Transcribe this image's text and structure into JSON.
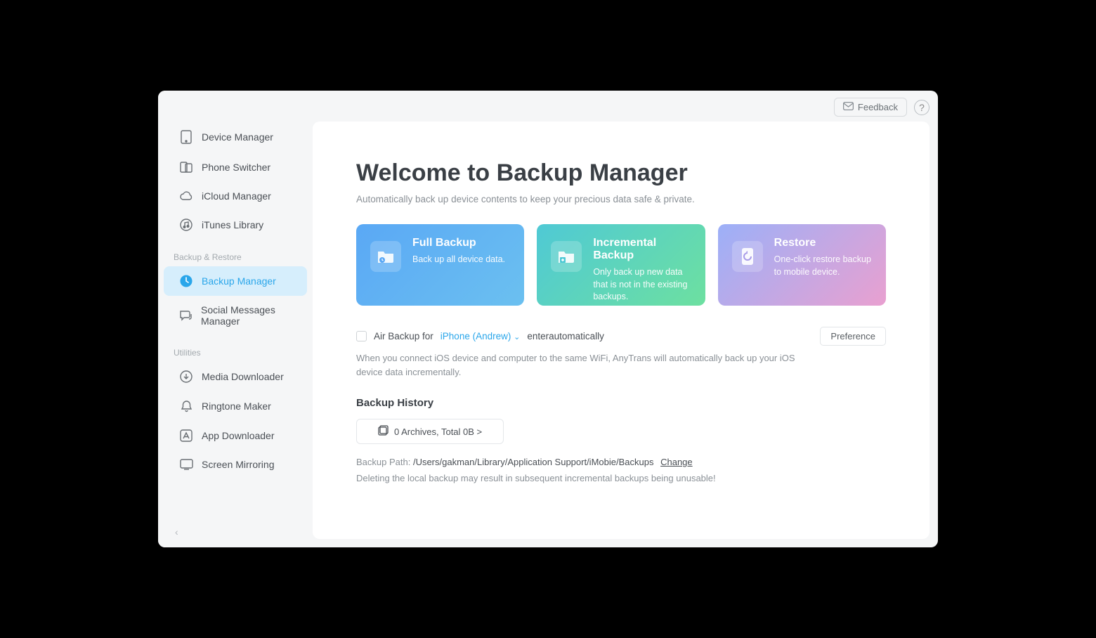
{
  "header": {
    "feedback_label": "Feedback",
    "help_label": "?"
  },
  "sidebar": {
    "items_top": [
      {
        "label": "Device Manager"
      },
      {
        "label": "Phone Switcher"
      },
      {
        "label": "iCloud Manager"
      },
      {
        "label": "iTunes Library"
      }
    ],
    "section_backup": "Backup & Restore",
    "items_backup": [
      {
        "label": "Backup Manager",
        "active": true
      },
      {
        "label": "Social Messages Manager"
      }
    ],
    "section_util": "Utilities",
    "items_util": [
      {
        "label": "Media Downloader"
      },
      {
        "label": "Ringtone Maker"
      },
      {
        "label": "App Downloader"
      },
      {
        "label": "Screen Mirroring"
      }
    ]
  },
  "main": {
    "title": "Welcome to Backup Manager",
    "subtitle": "Automatically back up device contents to keep your precious data safe & private.",
    "cards": {
      "full": {
        "title": "Full Backup",
        "desc": "Back up all device data."
      },
      "inc": {
        "title": "Incremental Backup",
        "desc": "Only back up new data that is not in the existing backups."
      },
      "rest": {
        "title": "Restore",
        "desc": "One-click restore backup to mobile device."
      }
    },
    "air": {
      "prefix": "Air Backup for",
      "device": "iPhone (Andrew)",
      "suffix": "enterautomatically",
      "desc": "When you connect iOS device and computer to the same WiFi, AnyTrans will automatically back up your iOS device data incrementally.",
      "preference_label": "Preference"
    },
    "history": {
      "title": "Backup History",
      "archives_label": "0 Archives, Total  0B >",
      "path_label": "Backup Path: ",
      "path_value": "/Users/gakman/Library/Application Support/iMobie/Backups",
      "change_label": "Change",
      "warn": "Deleting the local backup may result in subsequent incremental backups being unusable!"
    }
  }
}
